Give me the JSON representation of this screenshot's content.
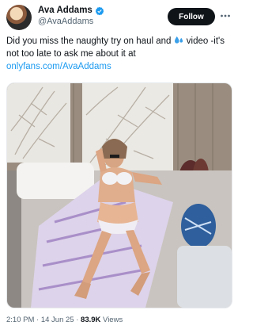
{
  "author": {
    "display_name": "Ava Addams",
    "handle": "@AvaAddams",
    "verified": true,
    "verified_color": "#1d9bf0"
  },
  "follow_button": {
    "label": "Follow"
  },
  "more_button": {
    "icon": "more-horizontal-icon"
  },
  "tweet": {
    "text_part1": "Did you miss the naughty try on haul and ",
    "emoji": "sweat-droplets-icon",
    "text_part2": " video -it's not too late to ask me about it at ",
    "link": "onlyfans.com/AvaAddams",
    "link_color": "#1d9bf0"
  },
  "media": {
    "type": "photo"
  },
  "meta": {
    "time": "2:10 PM",
    "sep1": " · ",
    "date": "14 Jun 25",
    "sep2": " · ",
    "views_count": "83.9K",
    "views_label": " Views"
  }
}
